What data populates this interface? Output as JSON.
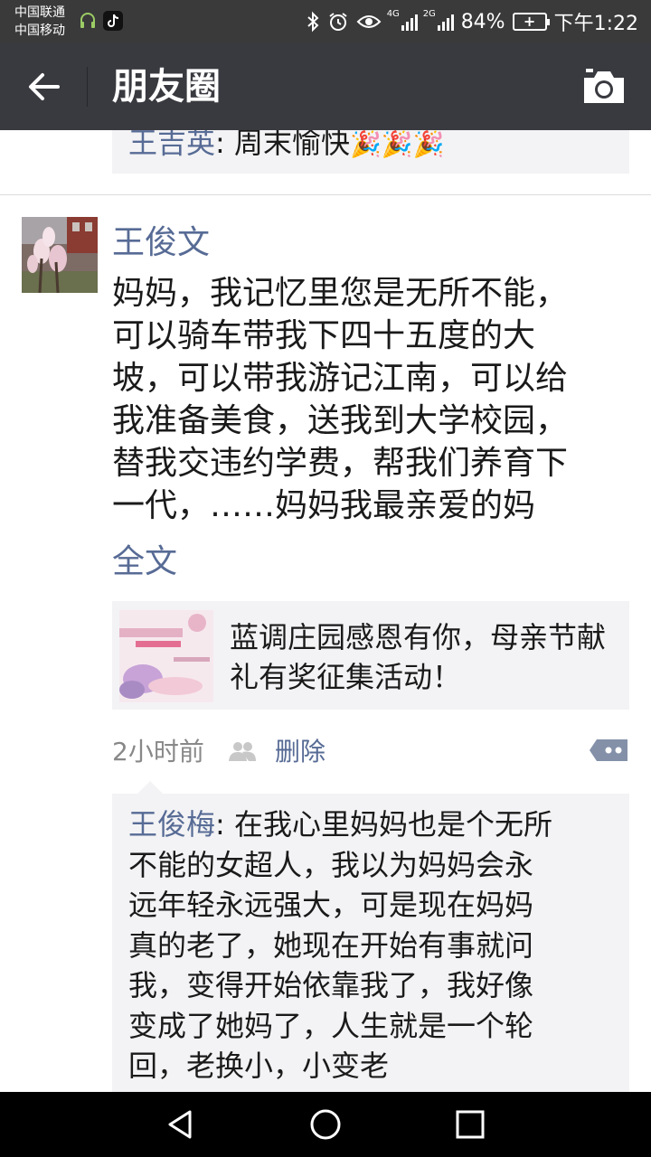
{
  "status_bar": {
    "carrier_1": "中国联通",
    "carrier_2": "中国移动",
    "signal_1_label": "4G",
    "signal_2_label": "2G",
    "battery_percent": "84%",
    "time": "下午1:22",
    "icons": [
      "headset-icon",
      "tiktok-icon",
      "bluetooth-icon",
      "alarm-icon",
      "eye-icon",
      "signal-icon",
      "battery-icon"
    ]
  },
  "title_bar": {
    "title": "朋友圈",
    "back_icon": "back-arrow-icon",
    "camera_icon": "camera-icon"
  },
  "previous_comment": {
    "author": "王吉英",
    "text": ": 周末愉快",
    "emoji": "🎉🎉🎉"
  },
  "post": {
    "author": "王俊文",
    "text": "妈妈，我记忆里您是无所不能，\n可以骑车带我下四十五度的大\n坡，可以带我游记江南，可以给\n我准备美食，送我到大学校园，\n替我交违约学费，帮我们养育下\n一代，……妈妈我最亲爱的妈",
    "full_text_link": "全文",
    "link_card": {
      "title": "蓝调庄园感恩有你，母亲节献礼有奖征集活动！"
    },
    "time": "2小时前",
    "delete_label": "删除",
    "friends_icon": "friends-icon",
    "more_icon": "more-dots-icon"
  },
  "comment": {
    "author": "王俊梅",
    "text": ": 在我心里妈妈也是个无所\n不能的女超人，我以为妈妈会永\n远年轻永远强大，可是现在妈妈\n真的老了，她现在开始有事就问\n我，变得开始依靠我了，我好像\n变成了她妈了，人生就是一个轮\n回，老换小，小变老"
  },
  "colors": {
    "status_bar_bg": "#3a3a3a",
    "title_bar_bg": "#393a3f",
    "link_blue": "#576b95",
    "card_bg": "#f3f3f5",
    "nav_bar_bg": "#000000"
  }
}
